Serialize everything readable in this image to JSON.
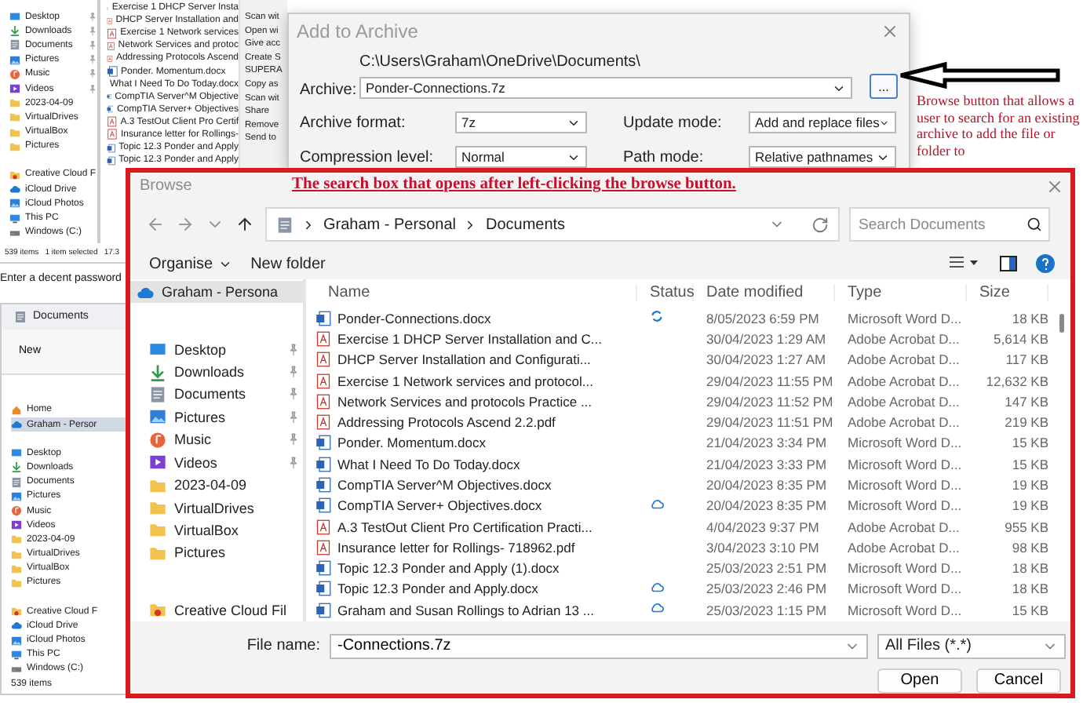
{
  "back_explorer": {
    "sidebar_groups": [
      {
        "items": [
          {
            "label": "Desktop",
            "kind": "desktop",
            "pinned": true
          },
          {
            "label": "Downloads",
            "kind": "download",
            "pinned": true
          },
          {
            "label": "Documents",
            "kind": "documents",
            "pinned": true
          },
          {
            "label": "Pictures",
            "kind": "pictures",
            "pinned": true
          },
          {
            "label": "Music",
            "kind": "music",
            "pinned": true
          },
          {
            "label": "Videos",
            "kind": "videos",
            "pinned": true
          },
          {
            "label": "2023-04-09",
            "kind": "folder",
            "pinned": false
          },
          {
            "label": "VirtualDrives",
            "kind": "folder",
            "pinned": false
          },
          {
            "label": "VirtualBox",
            "kind": "folder",
            "pinned": false
          },
          {
            "label": "Pictures",
            "kind": "folder",
            "pinned": false
          }
        ]
      },
      {
        "items": [
          {
            "label": "Creative Cloud F",
            "kind": "cc-folder",
            "pinned": false
          },
          {
            "label": "iCloud Drive",
            "kind": "cloud",
            "pinned": false
          },
          {
            "label": "iCloud Photos",
            "kind": "pictures",
            "pinned": false
          },
          {
            "label": "This PC",
            "kind": "pc",
            "pinned": false
          },
          {
            "label": "Windows (C:)",
            "kind": "drive",
            "pinned": false
          }
        ]
      }
    ],
    "files": [
      {
        "name": "Exercise 1 DHCP Server Insta",
        "kind": "pdf"
      },
      {
        "name": "DHCP Server Installation and",
        "kind": "pdf"
      },
      {
        "name": "Exercise 1 Network services",
        "kind": "pdf"
      },
      {
        "name": "Network Services and protoc",
        "kind": "pdf"
      },
      {
        "name": "Addressing Protocols Ascend",
        "kind": "pdf"
      },
      {
        "name": "Ponder. Momentum.docx",
        "kind": "word"
      },
      {
        "name": "What I Need To Do Today.docx",
        "kind": "word"
      },
      {
        "name": "CompTIA Server^M Objective",
        "kind": "word"
      },
      {
        "name": "CompTIA Server+ Objectives",
        "kind": "word"
      },
      {
        "name": "A.3 TestOut Client Pro Certif",
        "kind": "pdf"
      },
      {
        "name": "Insurance letter for Rollings-",
        "kind": "pdf"
      },
      {
        "name": "Topic 12.3 Ponder and Apply",
        "kind": "word"
      },
      {
        "name": "Topic 12.3 Ponder and Apply",
        "kind": "word"
      }
    ],
    "context_menu": [
      "Scan wit",
      "Open wi",
      "Give acc",
      "Create S",
      "SUPERA",
      "Copy as",
      "Scan wit",
      "Share",
      "Remove",
      "Send to"
    ],
    "status": [
      "539 items",
      "1 item selected",
      "17.3"
    ]
  },
  "caption": "Enter a decent password",
  "lower_explorer": {
    "title": "Documents",
    "new_button": "New",
    "sidebar_groups": [
      {
        "items": [
          {
            "label": "Home",
            "kind": "home",
            "selected": false
          },
          {
            "label": "Graham - Persor",
            "kind": "cloud",
            "selected": true
          }
        ]
      },
      {
        "items": [
          {
            "label": "Desktop",
            "kind": "desktop",
            "selected": false
          },
          {
            "label": "Downloads",
            "kind": "download",
            "selected": false
          },
          {
            "label": "Documents",
            "kind": "documents",
            "selected": false
          },
          {
            "label": "Pictures",
            "kind": "pictures",
            "selected": false
          },
          {
            "label": "Music",
            "kind": "music",
            "selected": false
          },
          {
            "label": "Videos",
            "kind": "videos",
            "selected": false
          },
          {
            "label": "2023-04-09",
            "kind": "folder",
            "selected": false
          },
          {
            "label": "VirtualDrives",
            "kind": "folder",
            "selected": false
          },
          {
            "label": "VirtualBox",
            "kind": "folder",
            "selected": false
          },
          {
            "label": "Pictures",
            "kind": "folder",
            "selected": false
          }
        ]
      },
      {
        "items": [
          {
            "label": "Creative Cloud F",
            "kind": "cc-folder",
            "selected": false
          },
          {
            "label": "iCloud Drive",
            "kind": "cloud",
            "selected": false
          },
          {
            "label": "iCloud Photos",
            "kind": "pictures",
            "selected": false
          },
          {
            "label": "This PC",
            "kind": "pc",
            "selected": false
          },
          {
            "label": "Windows (C:)",
            "kind": "drive",
            "selected": false
          }
        ]
      }
    ],
    "status": "539 items"
  },
  "archive_dialog": {
    "title": "Add to Archive",
    "archive_label": "Archive:",
    "archive_path": "C:\\Users\\Graham\\OneDrive\\Documents\\",
    "archive_name": "Ponder-Connections.7z",
    "browse_button": "...",
    "options": [
      {
        "label": "Archive format:",
        "value": "7z"
      },
      {
        "label": "Update mode:",
        "value": "Add and replace files"
      },
      {
        "label": "Compression level:",
        "value": "Normal"
      },
      {
        "label": "Path mode:",
        "value": "Relative pathnames"
      }
    ]
  },
  "annotations": [
    {
      "kind": "note",
      "text": "Browse button that allows a user to search for an existing archive to add the file or folder to"
    },
    {
      "kind": "heading",
      "text": "The search box that opens after left-clicking the browse button."
    }
  ],
  "browse_dialog": {
    "title": "Browse",
    "breadcrumb": [
      "Graham - Personal",
      "Documents"
    ],
    "search": {
      "placeholder": "Search Documents"
    },
    "organise": "Organise",
    "new_folder": "New folder",
    "nav_groups": [
      {
        "items": [
          {
            "label": "Graham - Persona",
            "kind": "cloud",
            "pinned": false,
            "selected": true
          }
        ]
      },
      {
        "items": [
          {
            "label": "Desktop",
            "kind": "desktop",
            "pinned": true,
            "selected": false
          },
          {
            "label": "Downloads",
            "kind": "download",
            "pinned": true,
            "selected": false
          },
          {
            "label": "Documents",
            "kind": "documents",
            "pinned": true,
            "selected": false
          },
          {
            "label": "Pictures",
            "kind": "pictures",
            "pinned": true,
            "selected": false
          },
          {
            "label": "Music",
            "kind": "music",
            "pinned": true,
            "selected": false
          },
          {
            "label": "Videos",
            "kind": "videos",
            "pinned": true,
            "selected": false
          },
          {
            "label": "2023-04-09",
            "kind": "folder",
            "pinned": false,
            "selected": false
          },
          {
            "label": "VirtualDrives",
            "kind": "folder",
            "pinned": false,
            "selected": false
          },
          {
            "label": "VirtualBox",
            "kind": "folder",
            "pinned": false,
            "selected": false
          },
          {
            "label": "Pictures",
            "kind": "folder",
            "pinned": false,
            "selected": false
          }
        ]
      },
      {
        "items": [
          {
            "label": "Creative Cloud Fil",
            "kind": "cc-folder",
            "pinned": false,
            "selected": false
          }
        ]
      }
    ],
    "columns": [
      "Name",
      "Status",
      "Date modified",
      "Type",
      "Size"
    ],
    "rows": [
      {
        "name": "Ponder-Connections.docx",
        "kind": "word",
        "syncing": true,
        "online_only": false,
        "date": "8/05/2023 6:59 PM",
        "type": "Microsoft Word D...",
        "size": "18 KB"
      },
      {
        "name": "Exercise 1 DHCP Server Installation and C...",
        "kind": "pdf",
        "syncing": false,
        "online_only": false,
        "date": "30/04/2023 1:29 AM",
        "type": "Adobe Acrobat D...",
        "size": "5,614 KB"
      },
      {
        "name": "DHCP Server Installation and Configurati...",
        "kind": "pdf",
        "syncing": false,
        "online_only": false,
        "date": "30/04/2023 1:27 AM",
        "type": "Adobe Acrobat D...",
        "size": "117 KB"
      },
      {
        "name": "Exercise 1 Network services and protocol...",
        "kind": "pdf",
        "syncing": false,
        "online_only": false,
        "date": "29/04/2023 11:55 PM",
        "type": "Adobe Acrobat D...",
        "size": "12,632 KB"
      },
      {
        "name": "Network Services and protocols Practice ...",
        "kind": "pdf",
        "syncing": false,
        "online_only": false,
        "date": "29/04/2023 11:52 PM",
        "type": "Adobe Acrobat D...",
        "size": "147 KB"
      },
      {
        "name": "Addressing Protocols Ascend 2.2.pdf",
        "kind": "pdf",
        "syncing": false,
        "online_only": false,
        "date": "29/04/2023 11:51 PM",
        "type": "Adobe Acrobat D...",
        "size": "219 KB"
      },
      {
        "name": "Ponder. Momentum.docx",
        "kind": "word",
        "syncing": false,
        "online_only": false,
        "date": "21/04/2023 3:34 PM",
        "type": "Microsoft Word D...",
        "size": "15 KB"
      },
      {
        "name": "What I Need To Do Today.docx",
        "kind": "word",
        "syncing": false,
        "online_only": false,
        "date": "21/04/2023 3:33 PM",
        "type": "Microsoft Word D...",
        "size": "15 KB"
      },
      {
        "name": "CompTIA Server^M Objectives.docx",
        "kind": "word",
        "syncing": false,
        "online_only": false,
        "date": "20/04/2023 8:35 PM",
        "type": "Microsoft Word D...",
        "size": "19 KB"
      },
      {
        "name": "CompTIA Server+ Objectives.docx",
        "kind": "word",
        "syncing": false,
        "online_only": true,
        "date": "20/04/2023 8:35 PM",
        "type": "Microsoft Word D...",
        "size": "19 KB"
      },
      {
        "name": "A.3 TestOut Client Pro Certification Practi...",
        "kind": "pdf",
        "syncing": false,
        "online_only": false,
        "date": "4/04/2023 9:37 PM",
        "type": "Adobe Acrobat D...",
        "size": "955 KB"
      },
      {
        "name": "Insurance letter for Rollings- 718962.pdf",
        "kind": "pdf",
        "syncing": false,
        "online_only": false,
        "date": "3/04/2023 3:10 PM",
        "type": "Adobe Acrobat D...",
        "size": "98 KB"
      },
      {
        "name": "Topic 12.3 Ponder and Apply (1).docx",
        "kind": "word",
        "syncing": false,
        "online_only": false,
        "date": "25/03/2023 2:51 PM",
        "type": "Microsoft Word D...",
        "size": "18 KB"
      },
      {
        "name": "Topic 12.3 Ponder and Apply.docx",
        "kind": "word",
        "syncing": false,
        "online_only": true,
        "date": "25/03/2023 2:46 PM",
        "type": "Microsoft Word D...",
        "size": "18 KB"
      },
      {
        "name": "Graham and Susan Rollings to Adrian 13 ...",
        "kind": "word",
        "syncing": false,
        "online_only": true,
        "date": "25/03/2023 1:15 PM",
        "type": "Microsoft Word D...",
        "size": "15 KB"
      }
    ],
    "file_name_label": "File name:",
    "file_name": "-Connections.7z",
    "filter": "All Files (*.*)",
    "buttons": [
      "Open",
      "Cancel"
    ]
  }
}
